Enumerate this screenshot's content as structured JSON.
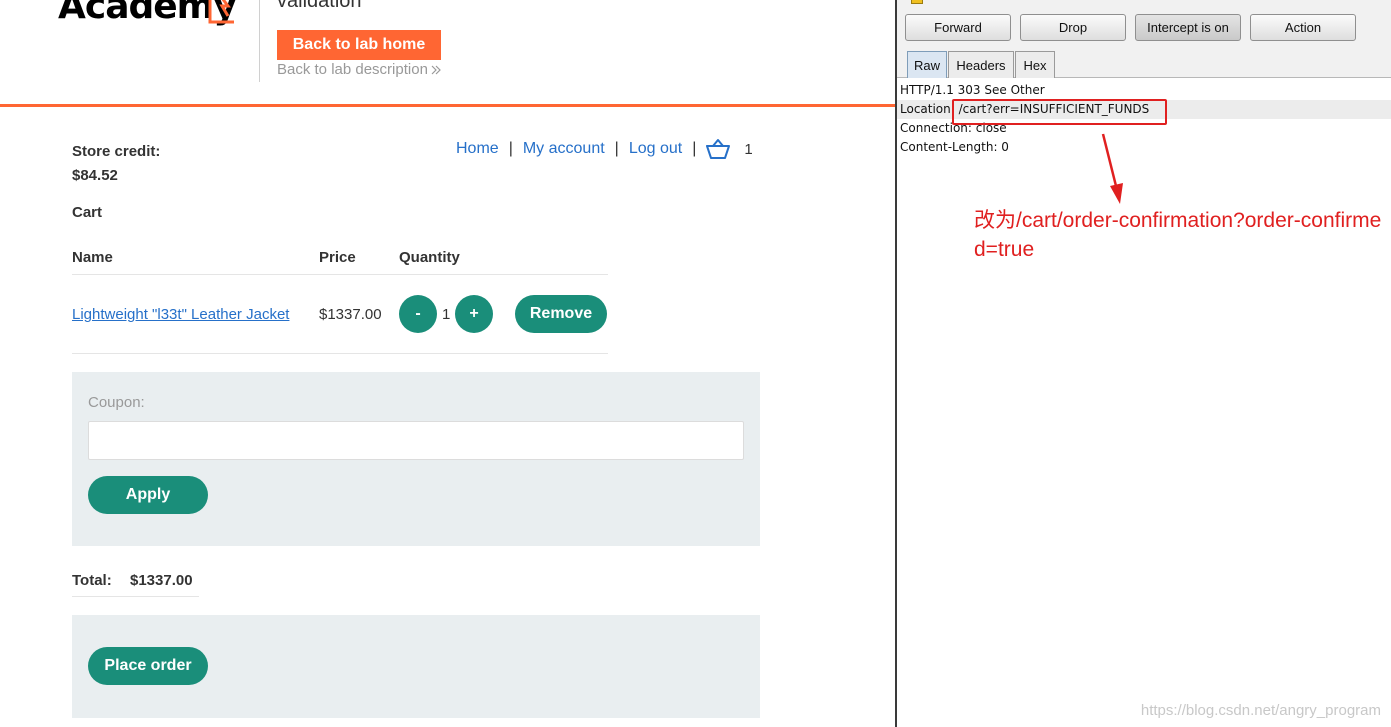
{
  "app": {
    "logo_text": "Academy",
    "lab_title": "validation",
    "back_home_label": "Back to lab home",
    "back_description_label": "Back to lab description",
    "store_credit_label": "Store credit:",
    "store_credit_value": "$84.52",
    "nav": {
      "home": "Home",
      "my_account": "My account",
      "log_out": "Log out",
      "separator": "|",
      "cart_count": "1"
    },
    "cart_heading": "Cart",
    "cart": {
      "columns": [
        "Name",
        "Price",
        "Quantity"
      ],
      "rows": [
        {
          "name": "Lightweight \"l33t\" Leather Jacket",
          "price": "$1337.00",
          "quantity": "1"
        }
      ],
      "minus_label": "-",
      "plus_label": "+",
      "remove_label": "Remove"
    },
    "coupon": {
      "label": "Coupon:",
      "value": "",
      "apply_label": "Apply"
    },
    "total": {
      "label": "Total:",
      "value": "$1337.00"
    },
    "place_order_label": "Place order",
    "colors": {
      "brand_orange": "#ff6633",
      "button_teal": "#1a8e7a",
      "link_blue": "#2670c9",
      "panel_grey": "#e9eef0"
    }
  },
  "burp": {
    "toolbar": {
      "forward": "Forward",
      "drop": "Drop",
      "intercept": "Intercept is on",
      "action": "Action"
    },
    "tabs": [
      "Raw",
      "Headers",
      "Hex"
    ],
    "active_tab": "Raw",
    "response_lines": [
      "HTTP/1.1 303 See Other",
      "Location: /cart?err=INSUFFICIENT_FUNDS",
      "Connection: close",
      "Content-Length: 0"
    ],
    "annotation": "改为/cart/order-confirmation?order-confirmed=true",
    "annotation_color": "#e02020"
  },
  "watermark": "https://blog.csdn.net/angry_program"
}
